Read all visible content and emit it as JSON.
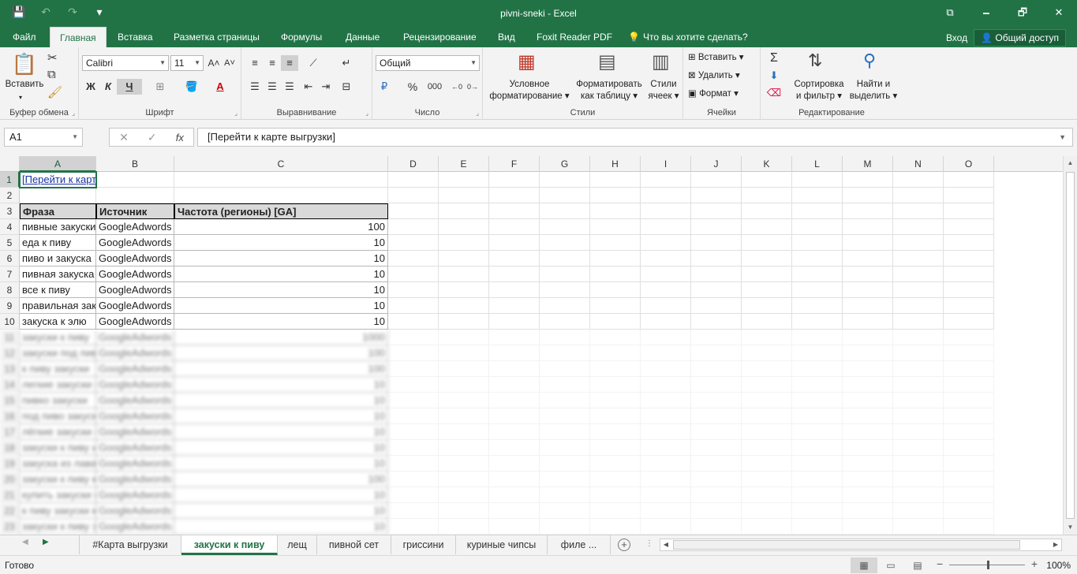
{
  "window": {
    "title": "pivni-sneki - Excel",
    "min": "🗕",
    "max": "🗗",
    "close": "✕",
    "ribbon_toggle": "⧉"
  },
  "qat": {
    "save": "💾",
    "undo": "↶",
    "redo": "↷",
    "customize": "▾"
  },
  "menu": {
    "file": "Файл",
    "tabs": [
      "Главная",
      "Вставка",
      "Разметка страницы",
      "Формулы",
      "Данные",
      "Рецензирование",
      "Вид",
      "Foxit Reader PDF"
    ],
    "tellme": "Что вы хотите сделать?",
    "signin": "Вход",
    "share": "Общий доступ"
  },
  "ribbon": {
    "clipboard": {
      "label": "Буфер обмена",
      "paste": "Вставить"
    },
    "font": {
      "label": "Шрифт",
      "name": "Calibri",
      "size": "11",
      "bold": "Ж",
      "italic": "К",
      "underline": "Ч"
    },
    "alignment": {
      "label": "Выравнивание"
    },
    "number": {
      "label": "Число",
      "format": "Общий",
      "percent": "%",
      "thousands": "000"
    },
    "styles": {
      "label": "Стили",
      "conditional": "Условное",
      "conditional2": "форматирование",
      "astable": "Форматировать",
      "astable2": "как таблицу",
      "cellstyles": "Стили",
      "cellstyles2": "ячеек"
    },
    "cells": {
      "label": "Ячейки",
      "insert": "Вставить",
      "delete": "Удалить",
      "format": "Формат"
    },
    "editing": {
      "label": "Редактирование",
      "sort": "Сортировка",
      "sort2": "и фильтр",
      "find": "Найти и",
      "find2": "выделить"
    }
  },
  "formula_bar": {
    "name_box": "A1",
    "cancel": "✕",
    "enter": "✓",
    "fx": "fx",
    "content": "[Перейти к карте выгрузки]"
  },
  "columns": [
    "A",
    "B",
    "C",
    "D",
    "E",
    "F",
    "G",
    "H",
    "I",
    "J",
    "K",
    "L",
    "M",
    "N",
    "O"
  ],
  "cells": {
    "a1": "[Перейти к карте выгрузки]",
    "headers": [
      "Фраза",
      "Источник",
      "Частота (регионы) [GA]"
    ],
    "rows": [
      [
        "пивные закуски",
        "GoogleAdwords",
        "100"
      ],
      [
        "еда к пиву",
        "GoogleAdwords",
        "10"
      ],
      [
        "пиво и закуска",
        "GoogleAdwords",
        "10"
      ],
      [
        "пивная закуска",
        "GoogleAdwords",
        "10"
      ],
      [
        "все к пиву",
        "GoogleAdwords",
        "10"
      ],
      [
        "правильная закуска к пиву",
        "GoogleAdwords",
        "10"
      ],
      [
        "закуска к элю",
        "GoogleAdwords",
        "10"
      ]
    ],
    "blurred_rows": [
      [
        "закуски к пиву",
        "GoogleAdwords",
        "1000"
      ],
      [
        "закуски под пиво",
        "GoogleAdwords",
        "100"
      ],
      [
        "к пиву закуски",
        "GoogleAdwords",
        "100"
      ],
      [
        "легкие закуски к пиву",
        "GoogleAdwords",
        "10"
      ],
      [
        "пивко закуски",
        "GoogleAdwords",
        "10"
      ],
      [
        "под пиво закуски",
        "GoogleAdwords",
        "10"
      ],
      [
        "лёгкие закуски к пиву",
        "GoogleAdwords",
        "10"
      ],
      [
        "закуски к пиву из лаваша",
        "GoogleAdwords",
        "10"
      ],
      [
        "закуска из лаваша к пиву",
        "GoogleAdwords",
        "10"
      ],
      [
        "закуски к пиву купить",
        "GoogleAdwords",
        "100"
      ],
      [
        "купить закуски к пиву",
        "GoogleAdwords",
        "10"
      ],
      [
        "к пиву закуски купить",
        "GoogleAdwords",
        "10"
      ],
      [
        "закуски к пиву заказать",
        "GoogleAdwords",
        "10"
      ]
    ]
  },
  "sheets": [
    "#Карта выгрузки",
    "закуски к пиву",
    "лещ",
    "пивной сет",
    "гриссини",
    "куриные чипсы",
    "филе ..."
  ],
  "status": {
    "ready": "Готово",
    "zoom": "100%"
  }
}
